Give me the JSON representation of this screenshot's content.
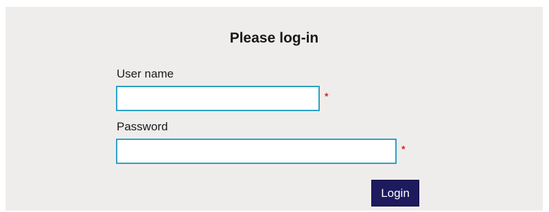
{
  "form": {
    "title": "Please log-in",
    "username": {
      "label": "User name",
      "value": "",
      "placeholder": "",
      "required_marker": "*"
    },
    "password": {
      "label": "Password",
      "value": "",
      "placeholder": "",
      "required_marker": "*"
    },
    "login_label": "Login"
  },
  "colors": {
    "panel_background": "#efedec",
    "input_border": "#2aa1c4",
    "required_marker": "#e02020",
    "button_background": "#1d1a5e",
    "button_text": "#ffffff"
  }
}
